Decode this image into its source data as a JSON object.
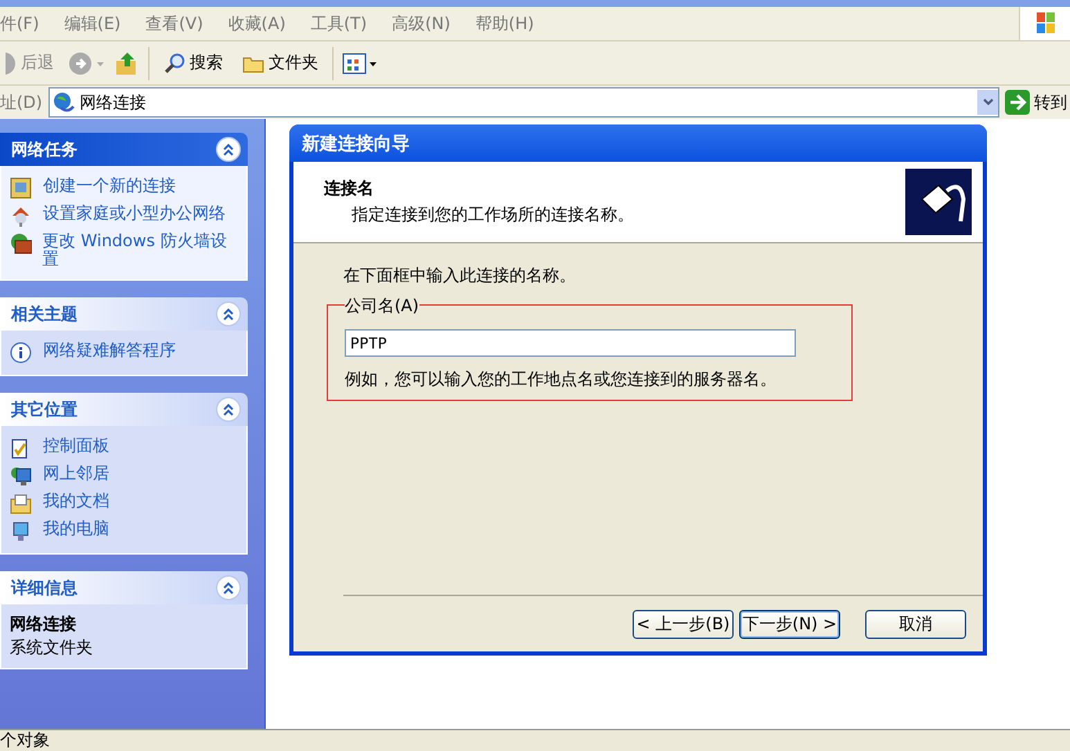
{
  "menu": [
    "件(F)",
    "编辑(E)",
    "查看(V)",
    "收藏(A)",
    "工具(T)",
    "高级(N)",
    "帮助(H)"
  ],
  "toolbar": {
    "back": "后退",
    "search": "搜索",
    "folders": "文件夹"
  },
  "address": {
    "label": "址(D)",
    "value": "网络连接",
    "go": "转到"
  },
  "sidebar": [
    {
      "title": "网络任务",
      "special": true,
      "links": [
        {
          "text": "创建一个新的连接",
          "kind": "new"
        },
        {
          "text": "设置家庭或小型办公网络",
          "kind": "home"
        },
        {
          "text": "更改 Windows 防火墙设置",
          "kind": "wall"
        }
      ]
    },
    {
      "title": "相关主题",
      "special": false,
      "links": [
        {
          "text": "网络疑难解答程序",
          "kind": "info"
        }
      ]
    },
    {
      "title": "其它位置",
      "special": false,
      "links": [
        {
          "text": "控制面板",
          "kind": "panel"
        },
        {
          "text": "网上邻居",
          "kind": "net"
        },
        {
          "text": "我的文档",
          "kind": "docs"
        },
        {
          "text": "我的电脑",
          "kind": "pc"
        }
      ]
    },
    {
      "title": "详细信息",
      "special": false,
      "details": {
        "name": "网络连接",
        "type": "系统文件夹"
      }
    }
  ],
  "status_bar": "个对象",
  "dialog": {
    "title": "新建连接向导",
    "heading": "连接名",
    "subheading": "指定连接到您的工作场所的连接名称。",
    "prompt": "在下面框中输入此连接的名称。",
    "field_label": "公司名(A)",
    "field_value": "PPTP",
    "hint": "例如，您可以输入您的工作地点名或您连接到的服务器名。",
    "buttons": [
      {
        "label": "< 上一步(B)",
        "focused": false
      },
      {
        "label": "下一步(N) >",
        "focused": true
      },
      {
        "label": "取消",
        "focused": false
      }
    ]
  }
}
